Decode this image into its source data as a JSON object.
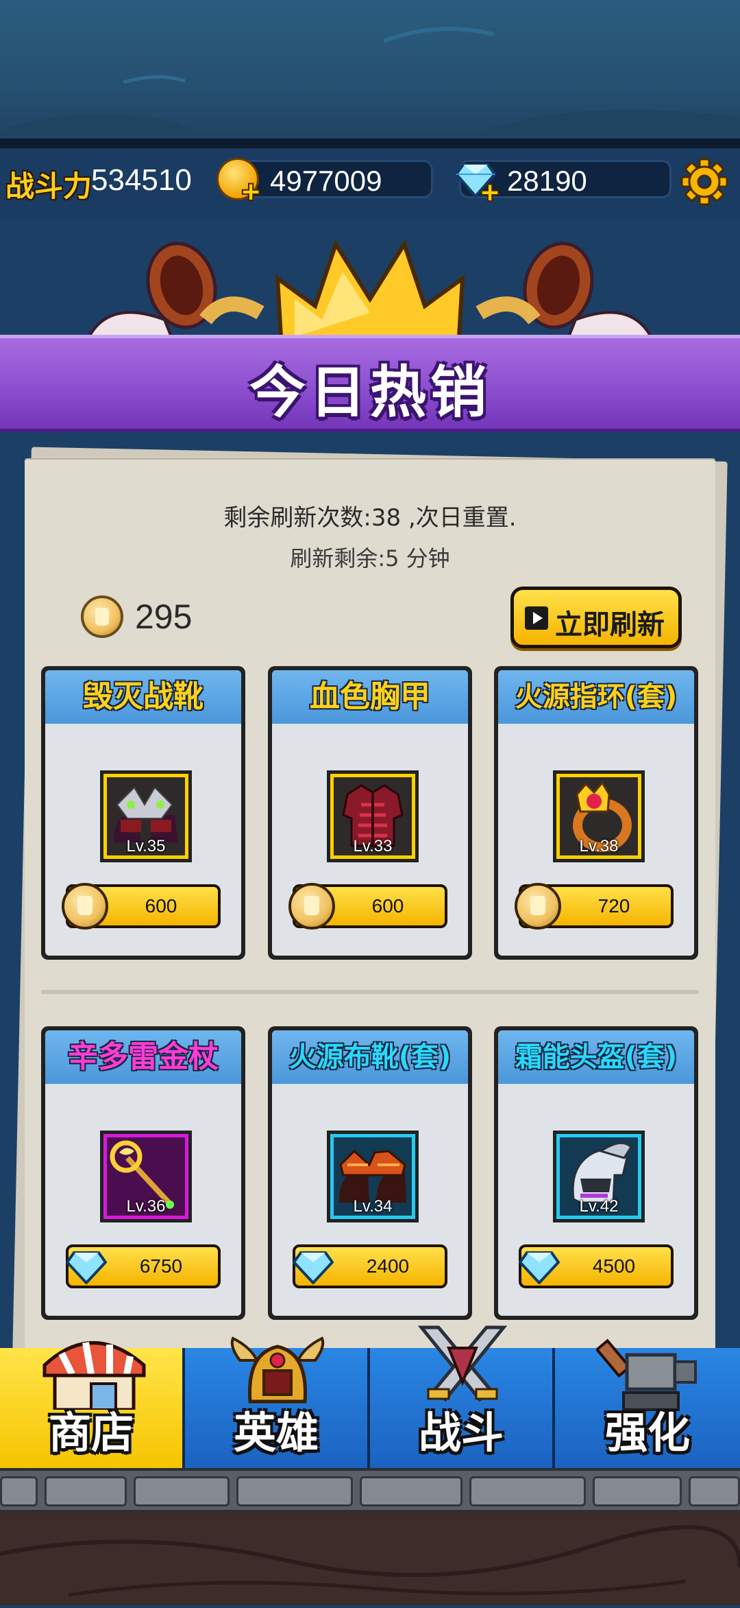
{
  "hud": {
    "power_label": "战斗力",
    "power_value": "534510",
    "gold_value": "4977009",
    "gems_value": "28190"
  },
  "banner": {
    "title": "今日热销"
  },
  "shop": {
    "refresh_remaining": "剩余刷新次数:38 ,次日重置.",
    "refresh_timer": "刷新剩余:5 分钟",
    "token_count": "295",
    "refresh_button": "立即刷新"
  },
  "items": [
    {
      "name": "毁灭战靴",
      "level": "Lv.35",
      "price": "600",
      "currency": "token",
      "name_color": "#ffd21a",
      "frame_color": "#ffd000",
      "icon": "boots-icon"
    },
    {
      "name": "血色胸甲",
      "level": "Lv.33",
      "price": "600",
      "currency": "token",
      "name_color": "#ffd21a",
      "frame_color": "#ffd000",
      "icon": "chest-armor-icon"
    },
    {
      "name": "火源指环(套)",
      "level": "Lv.38",
      "price": "720",
      "currency": "token",
      "name_color": "#ffd21a",
      "frame_color": "#ffd000",
      "icon": "ring-icon"
    },
    {
      "name": "辛多雷金杖",
      "level": "Lv.36",
      "price": "6750",
      "currency": "gem",
      "name_color": "#ff3cd8",
      "frame_color": "#d61adb",
      "icon": "staff-icon"
    },
    {
      "name": "火源布靴(套)",
      "level": "Lv.34",
      "price": "2400",
      "currency": "gem",
      "name_color": "#2ad8ff",
      "frame_color": "#27c9f0",
      "icon": "cloth-boots-icon"
    },
    {
      "name": "霜能头盔(套)",
      "level": "Lv.42",
      "price": "4500",
      "currency": "gem",
      "name_color": "#2ad8ff",
      "frame_color": "#27c9f0",
      "icon": "helmet-icon"
    }
  ],
  "nav": [
    {
      "label": "商店",
      "icon": "shop-icon",
      "active": true
    },
    {
      "label": "英雄",
      "icon": "hero-helmet-icon",
      "active": false
    },
    {
      "label": "战斗",
      "icon": "crossed-swords-icon",
      "active": false
    },
    {
      "label": "强化",
      "icon": "hammer-icon",
      "active": false
    }
  ]
}
